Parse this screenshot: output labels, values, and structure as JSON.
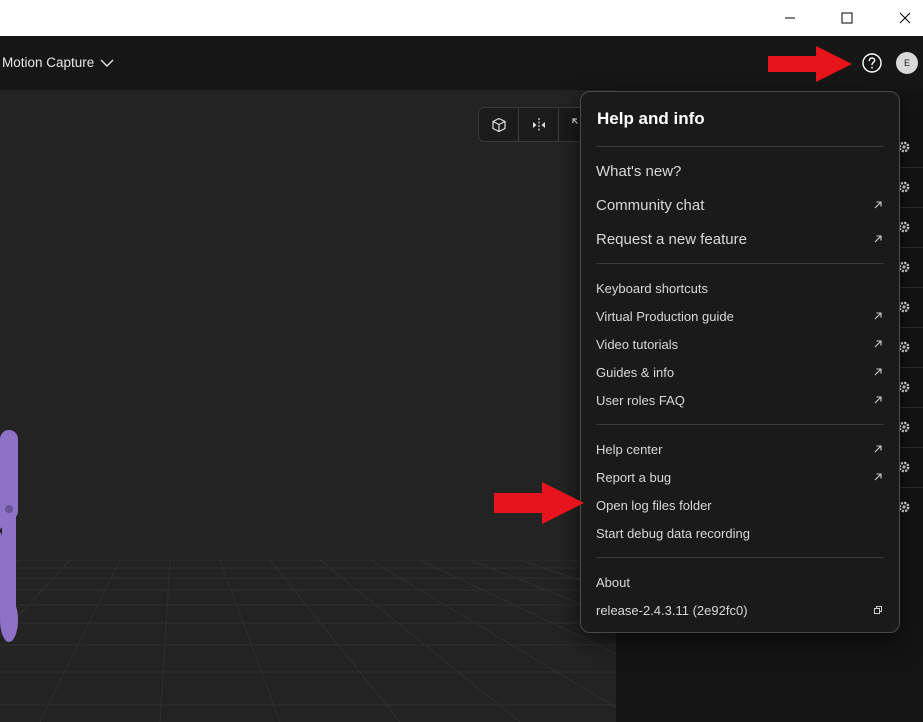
{
  "window": {
    "controls": [
      "minimize-icon",
      "maximize-icon",
      "close-icon"
    ]
  },
  "topbar": {
    "title": "Motion Capture",
    "avatar_initial": "E"
  },
  "viewport": {
    "toolbar_icons": [
      "cube-icon",
      "mirror-icon",
      "expand-icon"
    ]
  },
  "help_menu": {
    "title": "Help and info",
    "sections": [
      [
        {
          "label": "What's new?",
          "external": false
        },
        {
          "label": "Community chat",
          "external": true
        },
        {
          "label": "Request a new feature",
          "external": true
        }
      ],
      [
        {
          "label": "Keyboard shortcuts",
          "external": false
        },
        {
          "label": "Virtual Production guide",
          "external": true
        },
        {
          "label": "Video tutorials",
          "external": true
        },
        {
          "label": "Guides & info",
          "external": true
        },
        {
          "label": "User roles FAQ",
          "external": true
        }
      ],
      [
        {
          "label": "Help center",
          "external": true
        },
        {
          "label": "Report a bug",
          "external": true
        },
        {
          "label": "Open log files folder",
          "external": false
        },
        {
          "label": "Start debug data recording",
          "external": false
        }
      ],
      [
        {
          "label": "About",
          "external": false
        },
        {
          "label": "release-2.4.3.11 (2e92fc0)",
          "copy": true
        }
      ]
    ]
  },
  "colors": {
    "annotation_arrow": "#e8141c",
    "mannequin": "#8d72c8",
    "popup_bg": "#1a1a1a"
  }
}
